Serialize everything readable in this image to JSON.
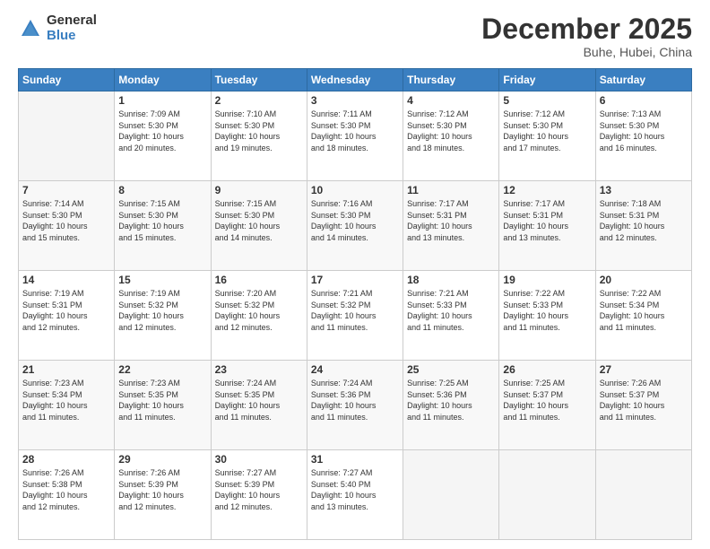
{
  "logo": {
    "general": "General",
    "blue": "Blue"
  },
  "title": "December 2025",
  "location": "Buhe, Hubei, China",
  "days_header": [
    "Sunday",
    "Monday",
    "Tuesday",
    "Wednesday",
    "Thursday",
    "Friday",
    "Saturday"
  ],
  "weeks": [
    [
      {
        "day": "",
        "info": ""
      },
      {
        "day": "1",
        "info": "Sunrise: 7:09 AM\nSunset: 5:30 PM\nDaylight: 10 hours\nand 20 minutes."
      },
      {
        "day": "2",
        "info": "Sunrise: 7:10 AM\nSunset: 5:30 PM\nDaylight: 10 hours\nand 19 minutes."
      },
      {
        "day": "3",
        "info": "Sunrise: 7:11 AM\nSunset: 5:30 PM\nDaylight: 10 hours\nand 18 minutes."
      },
      {
        "day": "4",
        "info": "Sunrise: 7:12 AM\nSunset: 5:30 PM\nDaylight: 10 hours\nand 18 minutes."
      },
      {
        "day": "5",
        "info": "Sunrise: 7:12 AM\nSunset: 5:30 PM\nDaylight: 10 hours\nand 17 minutes."
      },
      {
        "day": "6",
        "info": "Sunrise: 7:13 AM\nSunset: 5:30 PM\nDaylight: 10 hours\nand 16 minutes."
      }
    ],
    [
      {
        "day": "7",
        "info": "Sunrise: 7:14 AM\nSunset: 5:30 PM\nDaylight: 10 hours\nand 15 minutes."
      },
      {
        "day": "8",
        "info": "Sunrise: 7:15 AM\nSunset: 5:30 PM\nDaylight: 10 hours\nand 15 minutes."
      },
      {
        "day": "9",
        "info": "Sunrise: 7:15 AM\nSunset: 5:30 PM\nDaylight: 10 hours\nand 14 minutes."
      },
      {
        "day": "10",
        "info": "Sunrise: 7:16 AM\nSunset: 5:30 PM\nDaylight: 10 hours\nand 14 minutes."
      },
      {
        "day": "11",
        "info": "Sunrise: 7:17 AM\nSunset: 5:31 PM\nDaylight: 10 hours\nand 13 minutes."
      },
      {
        "day": "12",
        "info": "Sunrise: 7:17 AM\nSunset: 5:31 PM\nDaylight: 10 hours\nand 13 minutes."
      },
      {
        "day": "13",
        "info": "Sunrise: 7:18 AM\nSunset: 5:31 PM\nDaylight: 10 hours\nand 12 minutes."
      }
    ],
    [
      {
        "day": "14",
        "info": "Sunrise: 7:19 AM\nSunset: 5:31 PM\nDaylight: 10 hours\nand 12 minutes."
      },
      {
        "day": "15",
        "info": "Sunrise: 7:19 AM\nSunset: 5:32 PM\nDaylight: 10 hours\nand 12 minutes."
      },
      {
        "day": "16",
        "info": "Sunrise: 7:20 AM\nSunset: 5:32 PM\nDaylight: 10 hours\nand 12 minutes."
      },
      {
        "day": "17",
        "info": "Sunrise: 7:21 AM\nSunset: 5:32 PM\nDaylight: 10 hours\nand 11 minutes."
      },
      {
        "day": "18",
        "info": "Sunrise: 7:21 AM\nSunset: 5:33 PM\nDaylight: 10 hours\nand 11 minutes."
      },
      {
        "day": "19",
        "info": "Sunrise: 7:22 AM\nSunset: 5:33 PM\nDaylight: 10 hours\nand 11 minutes."
      },
      {
        "day": "20",
        "info": "Sunrise: 7:22 AM\nSunset: 5:34 PM\nDaylight: 10 hours\nand 11 minutes."
      }
    ],
    [
      {
        "day": "21",
        "info": "Sunrise: 7:23 AM\nSunset: 5:34 PM\nDaylight: 10 hours\nand 11 minutes."
      },
      {
        "day": "22",
        "info": "Sunrise: 7:23 AM\nSunset: 5:35 PM\nDaylight: 10 hours\nand 11 minutes."
      },
      {
        "day": "23",
        "info": "Sunrise: 7:24 AM\nSunset: 5:35 PM\nDaylight: 10 hours\nand 11 minutes."
      },
      {
        "day": "24",
        "info": "Sunrise: 7:24 AM\nSunset: 5:36 PM\nDaylight: 10 hours\nand 11 minutes."
      },
      {
        "day": "25",
        "info": "Sunrise: 7:25 AM\nSunset: 5:36 PM\nDaylight: 10 hours\nand 11 minutes."
      },
      {
        "day": "26",
        "info": "Sunrise: 7:25 AM\nSunset: 5:37 PM\nDaylight: 10 hours\nand 11 minutes."
      },
      {
        "day": "27",
        "info": "Sunrise: 7:26 AM\nSunset: 5:37 PM\nDaylight: 10 hours\nand 11 minutes."
      }
    ],
    [
      {
        "day": "28",
        "info": "Sunrise: 7:26 AM\nSunset: 5:38 PM\nDaylight: 10 hours\nand 12 minutes."
      },
      {
        "day": "29",
        "info": "Sunrise: 7:26 AM\nSunset: 5:39 PM\nDaylight: 10 hours\nand 12 minutes."
      },
      {
        "day": "30",
        "info": "Sunrise: 7:27 AM\nSunset: 5:39 PM\nDaylight: 10 hours\nand 12 minutes."
      },
      {
        "day": "31",
        "info": "Sunrise: 7:27 AM\nSunset: 5:40 PM\nDaylight: 10 hours\nand 13 minutes."
      },
      {
        "day": "",
        "info": ""
      },
      {
        "day": "",
        "info": ""
      },
      {
        "day": "",
        "info": ""
      }
    ]
  ]
}
